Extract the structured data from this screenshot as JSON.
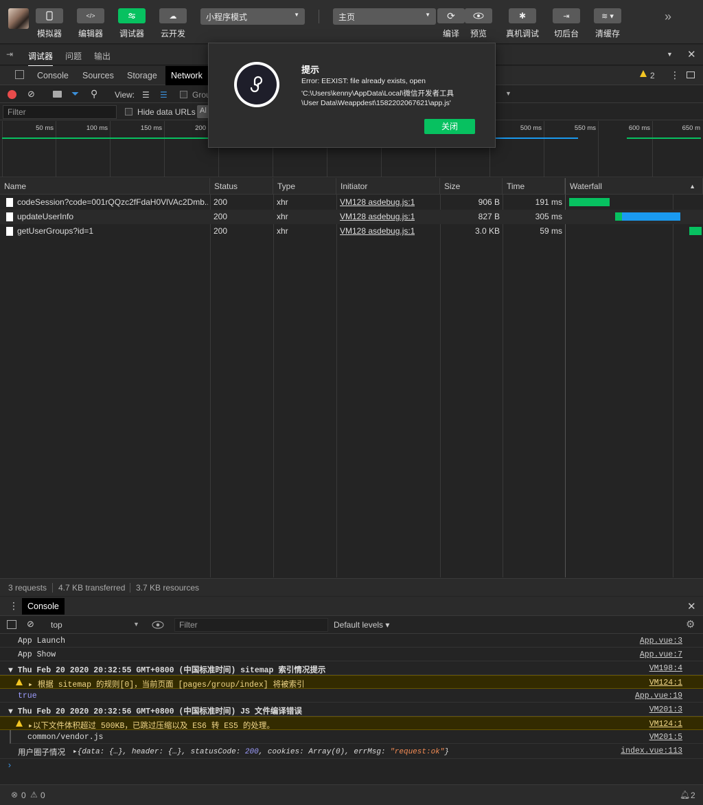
{
  "toolbar": {
    "buttons": [
      {
        "label": "模拟器",
        "icon": "phone-icon"
      },
      {
        "label": "编辑器",
        "icon": "code-icon"
      },
      {
        "label": "调试器",
        "icon": "sliders-icon"
      },
      {
        "label": "云开发",
        "icon": "cloud-icon"
      }
    ],
    "mode_select": "小程序模式",
    "page_select": "主页",
    "right_buttons": [
      {
        "label": "编译",
        "icon": "refresh-icon"
      },
      {
        "label": "预览",
        "icon": "eye-icon"
      },
      {
        "label": "真机调试",
        "icon": "bug-icon"
      },
      {
        "label": "切后台",
        "icon": "switch-icon"
      },
      {
        "label": "清缓存",
        "icon": "layers-icon"
      }
    ],
    "more": "»"
  },
  "panel_tabs": [
    "调试器",
    "问题",
    "输出"
  ],
  "devtools_tabs": [
    "Console",
    "Sources",
    "Storage",
    "Network"
  ],
  "warning_count": "2",
  "network": {
    "view_label": "View:",
    "group_label": "Grou",
    "filter_placeholder": "Filter",
    "hide_data_urls": "Hide data URLs",
    "all_label": "Al",
    "ticks": [
      "50 ms",
      "100 ms",
      "150 ms",
      "200",
      "500 ms",
      "550 ms",
      "600 ms",
      "650 m"
    ],
    "columns": [
      "Name",
      "Status",
      "Type",
      "Initiator",
      "Size",
      "Time",
      "Waterfall"
    ],
    "requests": [
      {
        "name": "codeSession?code=001rQQzc2fFdaH0VlVAc2Dmb...",
        "status": "200",
        "type": "xhr",
        "initiator": "VM128 asdebug.js:1",
        "size": "906 B",
        "time": "191 ms"
      },
      {
        "name": "updateUserInfo",
        "status": "200",
        "type": "xhr",
        "initiator": "VM128 asdebug.js:1",
        "size": "827 B",
        "time": "305 ms"
      },
      {
        "name": "getUserGroups?id=1",
        "status": "200",
        "type": "xhr",
        "initiator": "VM128 asdebug.js:1",
        "size": "3.0 KB",
        "time": "59 ms"
      }
    ],
    "summary": {
      "requests": "3 requests",
      "transferred": "4.7 KB transferred",
      "resources": "3.7 KB resources"
    }
  },
  "console": {
    "tab": "Console",
    "context": "top",
    "filter_placeholder": "Filter",
    "levels": "Default levels ▾",
    "logs": [
      {
        "text": "App Launch",
        "src": "App.vue:3"
      },
      {
        "text": "App Show",
        "src": "App.vue:7"
      },
      {
        "text": "▼ Thu Feb 20 2020 20:32:55 GMT+0800 (中国标准时间) sitemap 索引情况提示",
        "src": "VM198:4"
      },
      {
        "text": "根据 sitemap 的规则[0]，当前页面 [pages/group/index] 将被索引",
        "src": "VM124:1"
      },
      {
        "text": "true",
        "src": "App.vue:19"
      },
      {
        "text": "▼ Thu Feb 20 2020 20:32:56 GMT+0800 (中国标准时间) JS 文件编译错误",
        "src": "VM201:3"
      },
      {
        "text": "以下文件体积超过 500KB，已跳过压缩以及 ES6 转 ES5 的处理。",
        "src": "VM124:1"
      },
      {
        "text": "common/vendor.js",
        "src": "VM201:5"
      },
      {
        "text": "用户圈子情况",
        "src": "index.vue:113"
      }
    ],
    "object_preview": {
      "prefix": "▸{",
      "k1": "data: ",
      "v1": "{…}",
      "k2": ", header: ",
      "v2": "{…}",
      "k3": ", statusCode: ",
      "v3": "200",
      "k4": ", cookies: ",
      "v4": "Array(0)",
      "k5": ", errMsg: ",
      "v5": "\"request:ok\"",
      "suffix": "}"
    },
    "prompt": "›"
  },
  "bottom": {
    "errors": "0",
    "warnings": "0",
    "notifications": "2"
  },
  "modal": {
    "title": "提示",
    "lines": [
      "Error: EEXIST: file already exists, open",
      "'C:\\Users\\kenny\\AppData\\Local\\微信开发者工具",
      "\\User Data\\Weappdest\\1582202067621\\app.js'"
    ],
    "close_label": "关闭"
  },
  "colors": {
    "accent": "#07c160",
    "waterfall_blue": "#1a9af0",
    "warn_bg": "#332b00"
  }
}
